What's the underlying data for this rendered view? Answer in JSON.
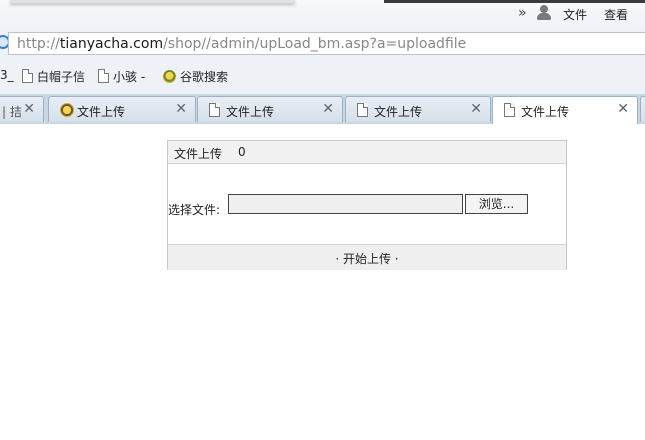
{
  "menu": {
    "file": "文件",
    "view": "查看",
    "overflow": "»"
  },
  "address": {
    "scheme": "http://",
    "host": "tianyacha.com",
    "path": "/shop//admin/upLoad_bm.asp?a=uploadfile"
  },
  "bookmarks": [
    {
      "label": "3_"
    },
    {
      "label": "白帽子信"
    },
    {
      "label": "小骇 -"
    },
    {
      "label": "谷歌搜索"
    }
  ],
  "tabs": {
    "partial_label": "| 拮",
    "items": [
      {
        "label": "文件上传"
      },
      {
        "label": "文件上传"
      },
      {
        "label": "文件上传"
      },
      {
        "label": "文件上传"
      }
    ],
    "close_glyph": "✕"
  },
  "form": {
    "title": "文件上传",
    "count": "0",
    "file_label": "选择文件:",
    "browse_label": "浏览...",
    "submit_label": "· 开始上传 ·"
  }
}
